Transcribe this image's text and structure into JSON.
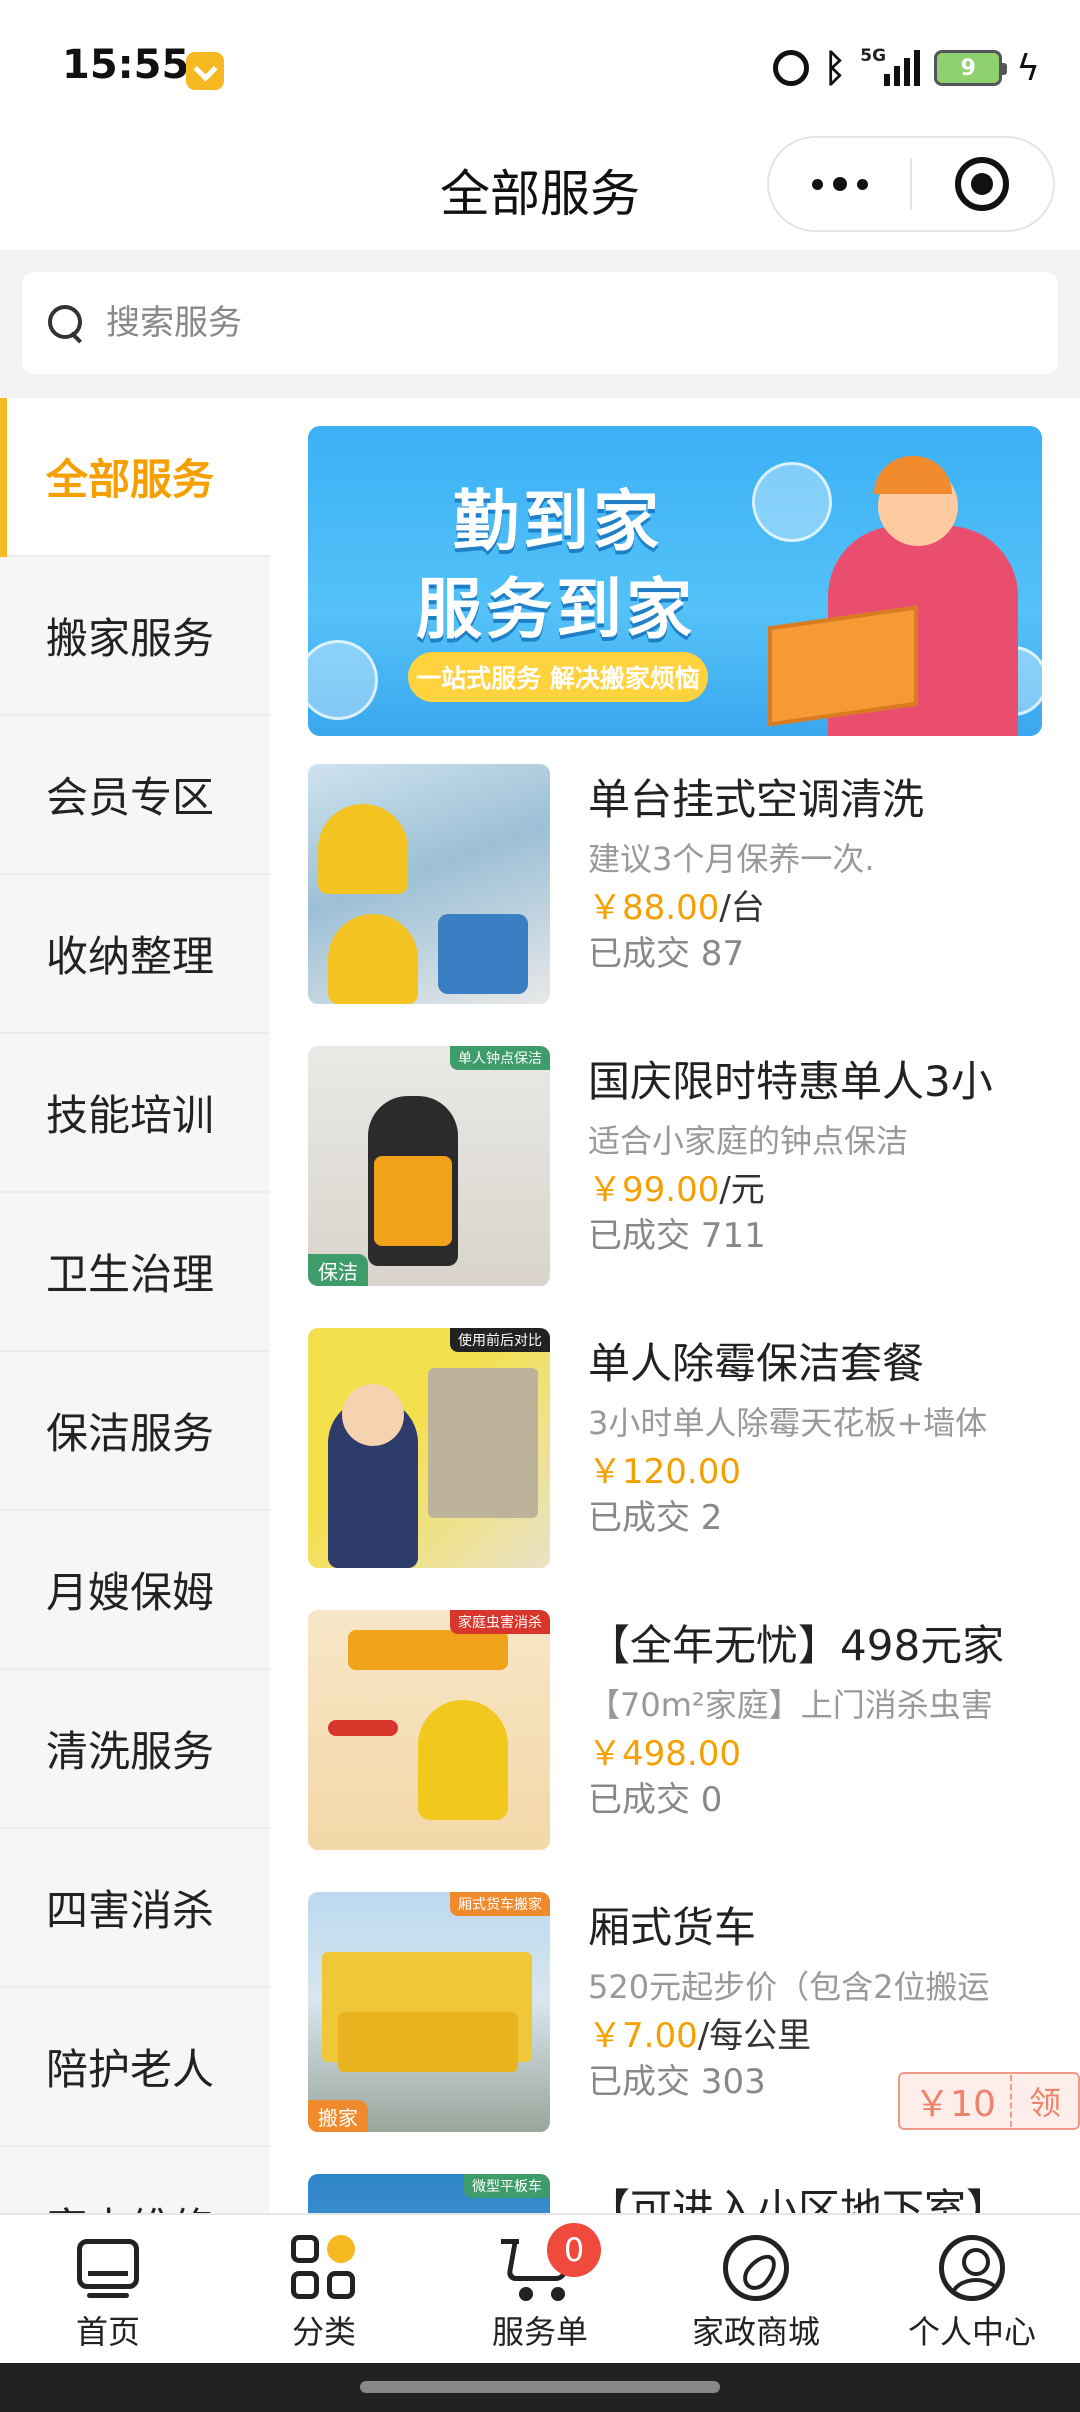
{
  "status_bar": {
    "time": "15:55",
    "network": "5G",
    "battery": "9",
    "icons": [
      "alarm-icon",
      "bluetooth-icon",
      "signal-icon",
      "battery-icon",
      "charging-icon"
    ]
  },
  "header": {
    "title": "全部服务",
    "more_icon": "more-dots-icon",
    "close_icon": "target-close-icon"
  },
  "search": {
    "placeholder": "搜索服务",
    "icon": "search-icon"
  },
  "sidebar": {
    "active_index": 0,
    "items": [
      {
        "label": "全部服务"
      },
      {
        "label": "搬家服务"
      },
      {
        "label": "会员专区"
      },
      {
        "label": "收纳整理"
      },
      {
        "label": "技能培训"
      },
      {
        "label": "卫生治理"
      },
      {
        "label": "保洁服务"
      },
      {
        "label": "月嫂保姆"
      },
      {
        "label": "清洗服务"
      },
      {
        "label": "四害消杀"
      },
      {
        "label": "陪护老人"
      },
      {
        "label": "家电维修"
      }
    ]
  },
  "banner": {
    "line1": "勤到家",
    "line2": "服务到家",
    "slogan": "一站式服务 解决搬家烦恼"
  },
  "services": [
    {
      "title": "单台挂式空调清洗",
      "subtitle": "建议3个月保养一次.",
      "currency": "￥",
      "price": "88.00",
      "unit": "/台",
      "sold": "已成交 87",
      "thumb_tag": "",
      "thumb_corner": ""
    },
    {
      "title": "国庆限时特惠单人3小",
      "subtitle": "适合小家庭的钟点保洁",
      "currency": "￥",
      "price": "99.00",
      "unit": "/元",
      "sold": "已成交 711",
      "thumb_tag": "保洁",
      "thumb_corner": "单人钟点保洁"
    },
    {
      "title": "单人除霉保洁套餐",
      "subtitle": "3小时单人除霉天花板+墙体",
      "currency": "￥",
      "price": "120.00",
      "unit": "",
      "sold": "已成交 2",
      "thumb_tag": "",
      "thumb_corner": "使用前后对比"
    },
    {
      "title": "【全年无忧】498元家",
      "subtitle": "【70m²家庭】上门消杀虫害",
      "currency": "￥",
      "price": "498.00",
      "unit": "",
      "sold": "已成交 0",
      "thumb_tag": "",
      "thumb_corner": "家庭虫害消杀"
    },
    {
      "title": "厢式货车",
      "subtitle": "520元起步价（包含2位搬运",
      "currency": "￥",
      "price": "7.00",
      "unit": "/每公里",
      "sold": "已成交 303",
      "thumb_tag": "搬家",
      "thumb_corner": "厢式货车搬家",
      "coupon_amount": "￥10",
      "coupon_action": "领"
    },
    {
      "title": "【可进入小区地下室】",
      "subtitle": "",
      "currency": "",
      "price": "",
      "unit": "",
      "sold": "",
      "thumb_tag": "",
      "thumb_corner": "微型平板车"
    }
  ],
  "tabbar": {
    "items": [
      {
        "label": "首页",
        "icon": "monitor-home-icon"
      },
      {
        "label": "分类",
        "icon": "grid-category-icon"
      },
      {
        "label": "服务单",
        "icon": "cart-icon",
        "badge": "0"
      },
      {
        "label": "家政商城",
        "icon": "compass-icon"
      },
      {
        "label": "个人中心",
        "icon": "user-icon"
      }
    ]
  },
  "colors": {
    "accent": "#f5a000",
    "accent_bar": "#f6b921",
    "badge": "#f04a3d",
    "coupon": "#f0826c"
  }
}
